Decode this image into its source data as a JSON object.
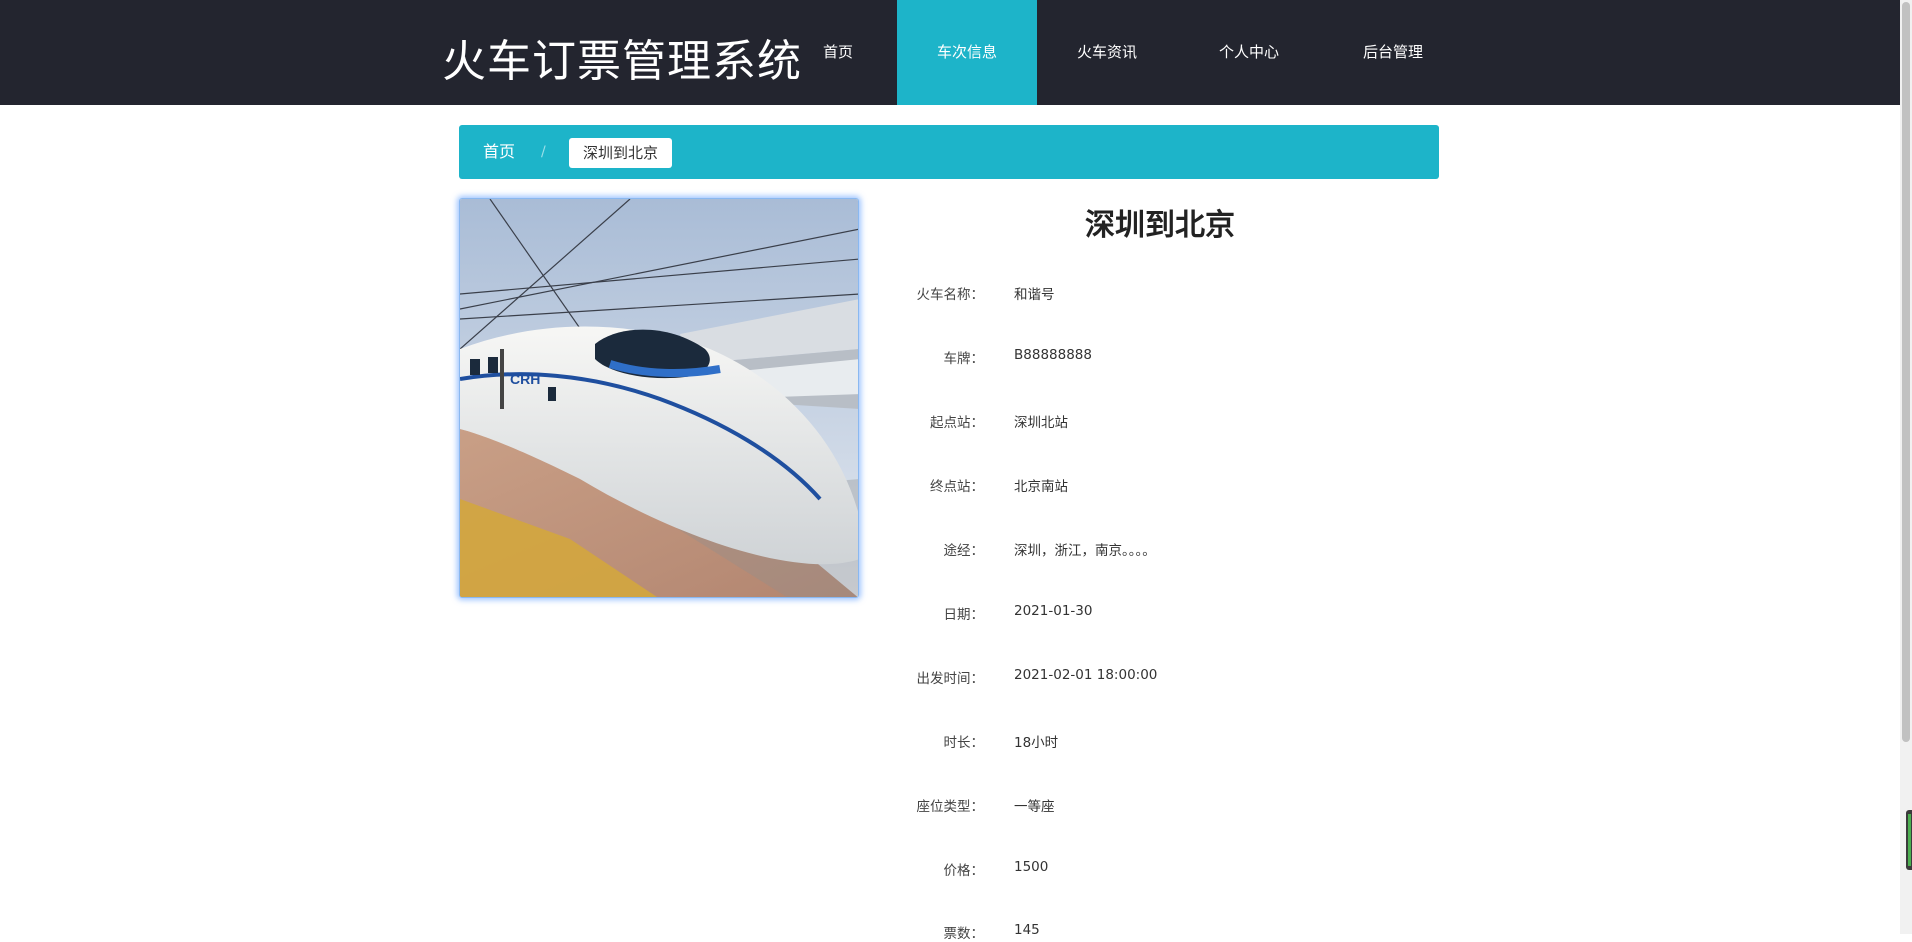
{
  "header": {
    "brand": "火车订票管理系统",
    "nav": [
      {
        "label": "首页",
        "active": false
      },
      {
        "label": "车次信息",
        "active": true
      },
      {
        "label": "火车资讯",
        "active": false
      },
      {
        "label": "个人中心",
        "active": false
      },
      {
        "label": "后台管理",
        "active": false
      }
    ]
  },
  "breadcrumb": {
    "home": "首页",
    "separator": "/",
    "current": "深圳到北京"
  },
  "detail": {
    "title": "深圳到北京",
    "fields": [
      {
        "label": "火车名称：",
        "value": "和谐号"
      },
      {
        "label": "车牌：",
        "value": "B88888888"
      },
      {
        "label": "起点站：",
        "value": "深圳北站"
      },
      {
        "label": "终点站：",
        "value": "北京南站"
      },
      {
        "label": "途经：",
        "value": "深圳，浙江，南京。。。。"
      },
      {
        "label": "日期：",
        "value": "2021-01-30"
      },
      {
        "label": "出发时间：",
        "value": "2021-02-01 18:00:00"
      },
      {
        "label": "时长：",
        "value": "18小时"
      },
      {
        "label": "座位类型：",
        "value": "一等座"
      },
      {
        "label": "价格：",
        "value": "1500"
      },
      {
        "label": "票数：",
        "value": "145"
      }
    ]
  },
  "colors": {
    "header_bg": "#23252f",
    "accent": "#1db4c9"
  },
  "image": {
    "icon": "train-photo",
    "train_logo_text": "CRH"
  }
}
